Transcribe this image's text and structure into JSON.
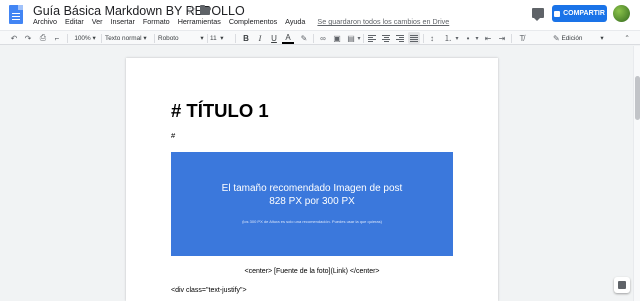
{
  "header": {
    "title": "Guía Básica Markdown BY REPOLLO",
    "menu": [
      "Archivo",
      "Editar",
      "Ver",
      "Insertar",
      "Formato",
      "Herramientas",
      "Complementos",
      "Ayuda"
    ],
    "saved_status": "Se guardaron todos los cambios en Drive",
    "share_label": "COMPARTIR"
  },
  "toolbar": {
    "zoom": "100%",
    "style": "Texto normal",
    "font": "Roboto",
    "size": "11",
    "mode": "Edición"
  },
  "document": {
    "heading": "# TÍTULO 1",
    "hash": "#",
    "banner_line1": "El tamaño recomendado Imagen de post",
    "banner_line2": "828 PX por 300 PX",
    "banner_note": "(los 300 PX de Altura es solo una recomendación. Puedes usar la que quieras)",
    "caption": "<center> [Fuente de la foto](Link) </center>",
    "div_line": "<div class=\"text-justify\">"
  },
  "colors": {
    "accent": "#1a73e8",
    "banner": "#3b78dc",
    "doc_icon": "#4285f4"
  }
}
